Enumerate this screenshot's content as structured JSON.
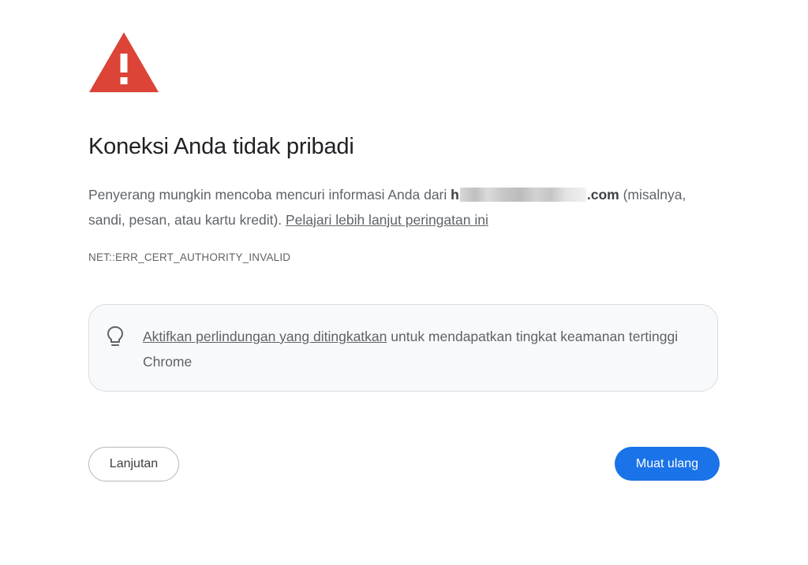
{
  "warning": {
    "icon": "warning-triangle-icon",
    "color": "#db4437"
  },
  "title": "Koneksi Anda tidak pribadi",
  "message": {
    "text_before_domain": "Penyerang mungkin mencoba mencuri informasi Anda dari ",
    "domain_start": "h",
    "domain_end": ".com",
    "text_after_domain": " (misalnya, sandi, pesan, atau kartu kredit). ",
    "learn_more_link": "Pelajari lebih lanjut peringatan ini"
  },
  "error_code": "NET::ERR_CERT_AUTHORITY_INVALID",
  "protection": {
    "icon": "lightbulb-icon",
    "link_text": "Aktifkan perlindungan yang ditingkatkan",
    "text": " untuk mendapatkan tingkat keamanan tertinggi Chrome"
  },
  "buttons": {
    "advanced_label": "Lanjutan",
    "reload_label": "Muat ulang"
  },
  "colors": {
    "primary": "#1a73e8",
    "text": "#5f6368",
    "heading": "#202124"
  }
}
